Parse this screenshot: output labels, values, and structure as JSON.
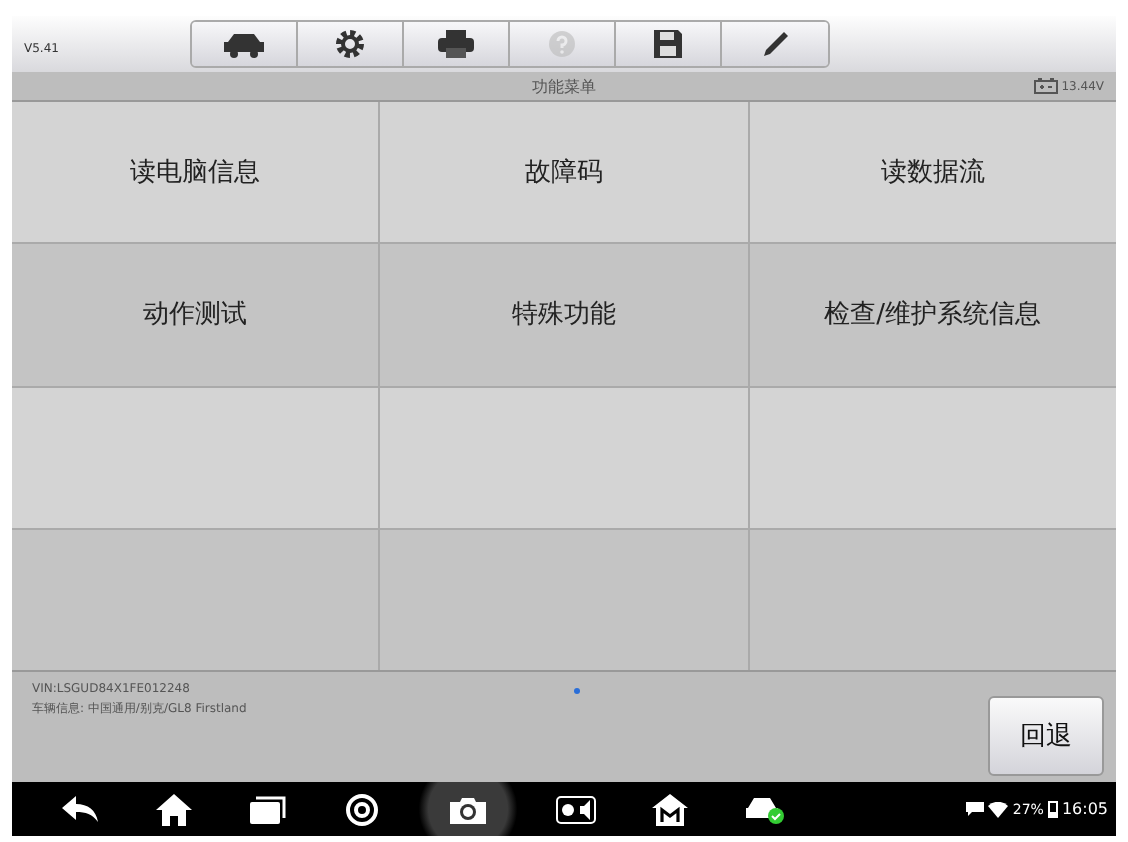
{
  "version": "V5.41",
  "toolbar": [
    {
      "kind": "car",
      "disabled": false
    },
    {
      "kind": "gear",
      "disabled": false
    },
    {
      "kind": "printer",
      "disabled": false
    },
    {
      "kind": "help",
      "disabled": true
    },
    {
      "kind": "save",
      "disabled": false
    },
    {
      "kind": "pen",
      "disabled": false
    }
  ],
  "title": "功能菜单",
  "battery": "13.44V",
  "menu_items": [
    {
      "label": "读电脑信息"
    },
    {
      "label": "故障码"
    },
    {
      "label": "读数据流"
    },
    {
      "label": "动作测试"
    },
    {
      "label": "特殊功能"
    },
    {
      "label": "检查/维护系统信息"
    }
  ],
  "vin": "VIN:LSGUD84X1FE012248",
  "vehicle_info": "车辆信息: 中国通用/别克/GL8 Firstland",
  "back_button": "回退",
  "nav": [
    {
      "kind": "back",
      "selected": false
    },
    {
      "kind": "home",
      "selected": false
    },
    {
      "kind": "recent",
      "selected": false
    },
    {
      "kind": "browser",
      "selected": false
    },
    {
      "kind": "camera",
      "selected": true
    },
    {
      "kind": "display",
      "selected": false
    },
    {
      "kind": "m-home",
      "selected": false
    },
    {
      "kind": "car-check",
      "selected": false
    }
  ],
  "status": {
    "battery": "27%",
    "time": "16:05"
  }
}
